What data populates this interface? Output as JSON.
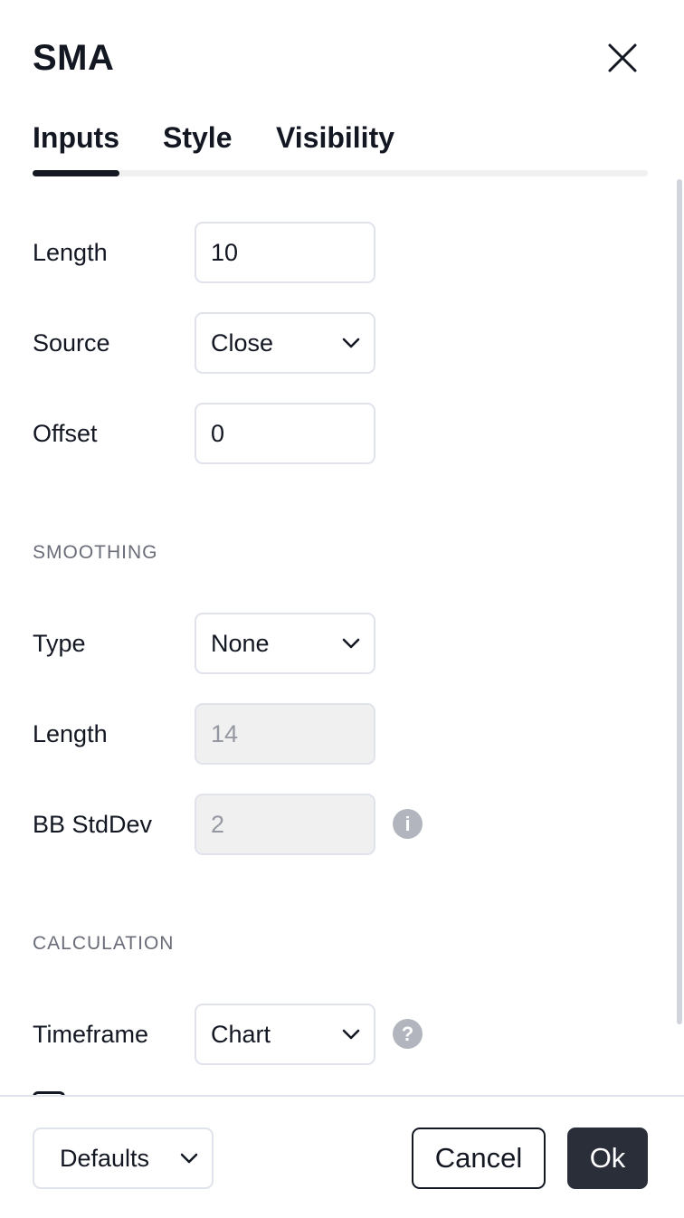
{
  "dialog": {
    "title": "SMA"
  },
  "tabs": [
    {
      "label": "Inputs",
      "active": true
    },
    {
      "label": "Style",
      "active": false
    },
    {
      "label": "Visibility",
      "active": false
    }
  ],
  "inputs": {
    "length": {
      "label": "Length",
      "value": "10"
    },
    "source": {
      "label": "Source",
      "value": "Close"
    },
    "offset": {
      "label": "Offset",
      "value": "0"
    }
  },
  "smoothing": {
    "section_title": "SMOOTHING",
    "type": {
      "label": "Type",
      "value": "None"
    },
    "length": {
      "label": "Length",
      "value": "14"
    },
    "bb_stddev": {
      "label": "BB StdDev",
      "value": "2"
    }
  },
  "calculation": {
    "section_title": "CALCULATION",
    "timeframe": {
      "label": "Timeframe",
      "value": "Chart"
    }
  },
  "icons": {
    "info": "info-icon",
    "help": "help-icon",
    "close": "close-icon",
    "chevron": "chevron-down-icon",
    "info_glyph": "i",
    "help_glyph": "?"
  },
  "footer": {
    "defaults_label": "Defaults",
    "cancel_label": "Cancel",
    "ok_label": "Ok"
  },
  "colors": {
    "text": "#131722",
    "border": "#e0e3eb",
    "ok_bg": "#2a2e39",
    "icon_gray": "#b2b5be"
  }
}
